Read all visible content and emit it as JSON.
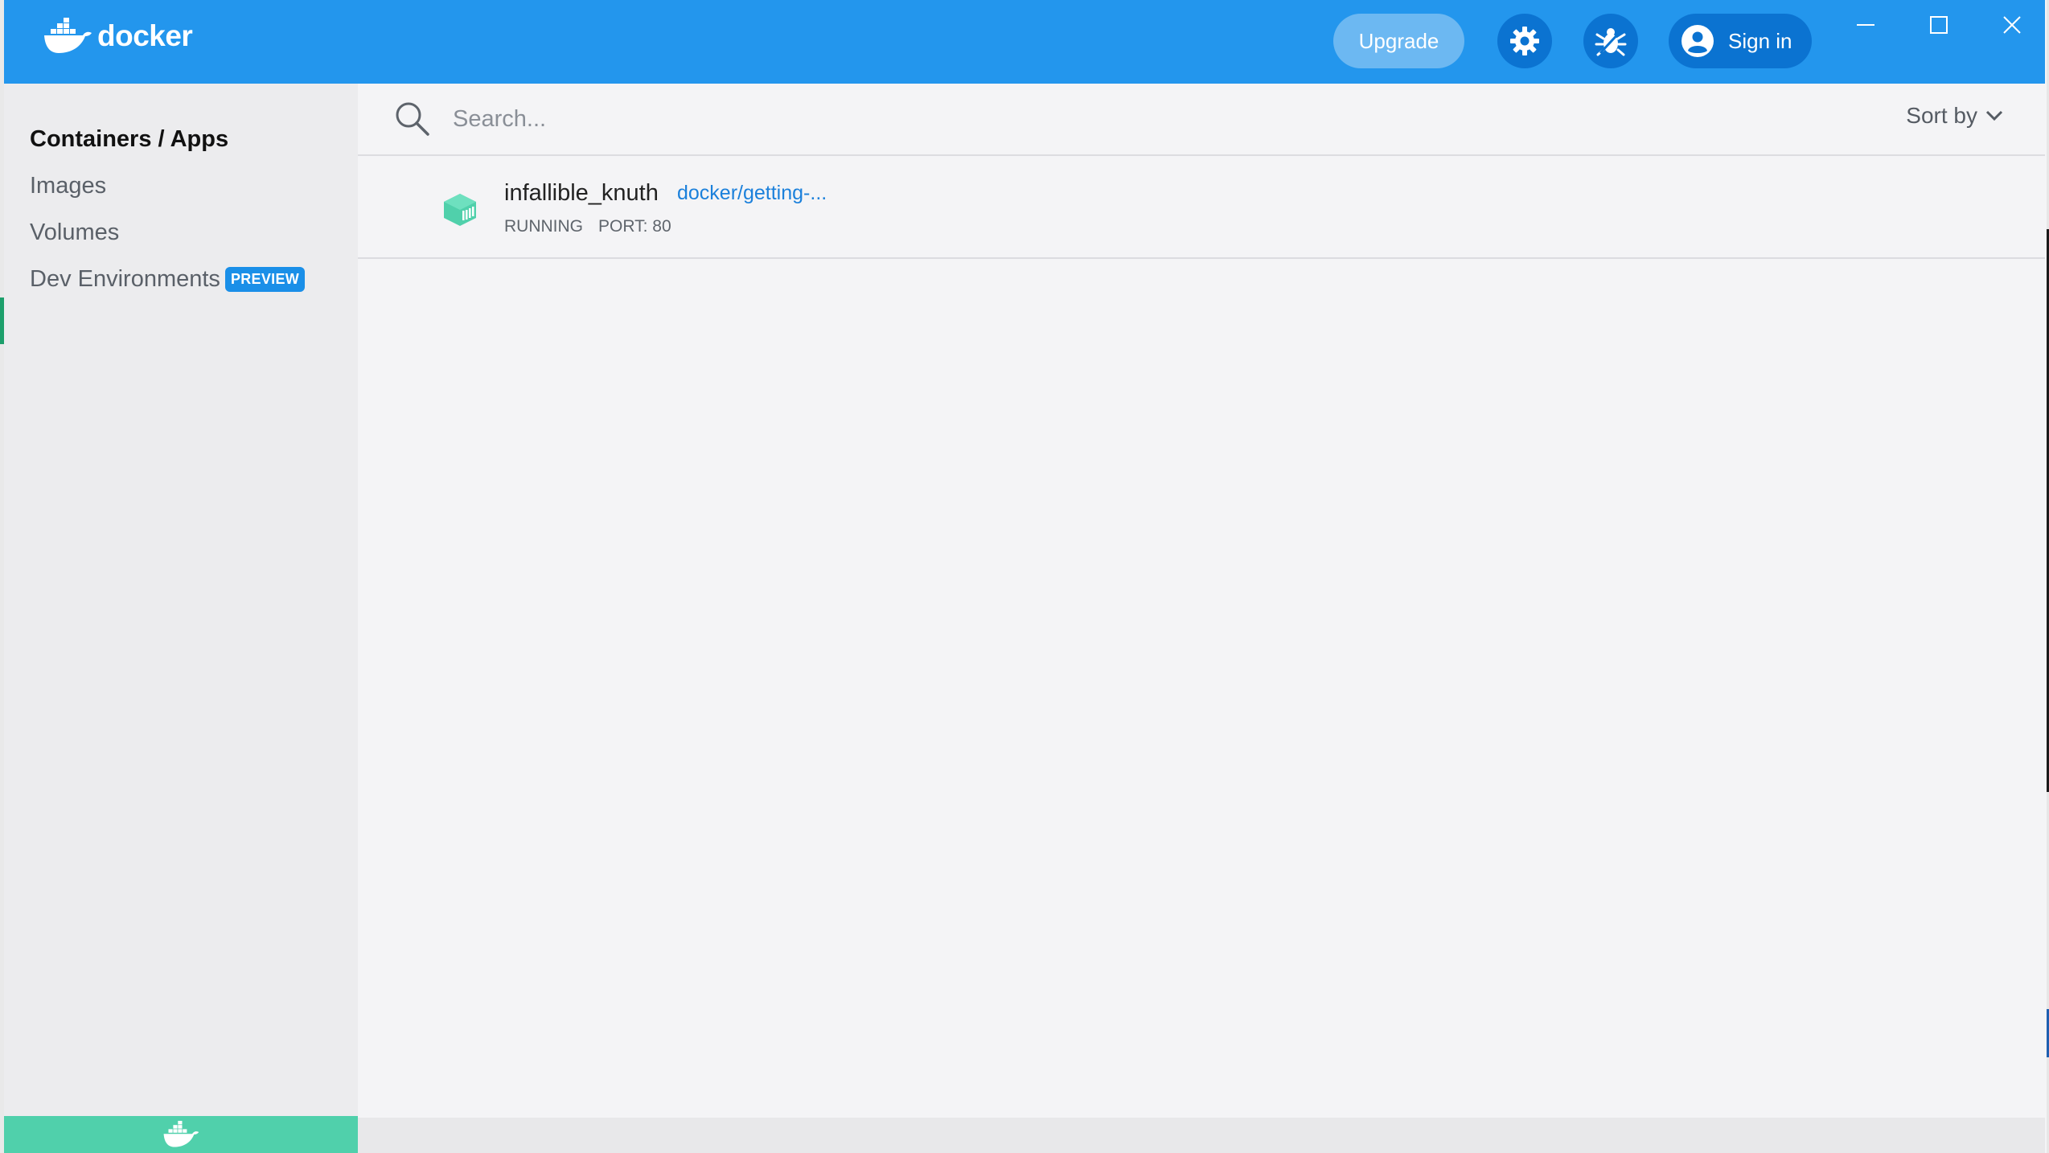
{
  "app": {
    "logo_text": "docker",
    "upgrade_label": "Upgrade",
    "signin_label": "Sign in"
  },
  "icons": {
    "settings": "gear-icon",
    "troubleshoot": "bug-icon",
    "account": "user-avatar-icon",
    "search": "search-icon",
    "sort": "chevron-down-icon",
    "container": "container-cube-icon",
    "footer": "docker-whale-icon"
  },
  "colors": {
    "header": "#2396ed",
    "accent": "#1b80db",
    "running": "#50d0ab",
    "preview_badge": "#1a8fe8"
  },
  "sidebar": {
    "items": [
      {
        "label": "Containers / Apps",
        "active": true
      },
      {
        "label": "Images"
      },
      {
        "label": "Volumes"
      },
      {
        "label": "Dev Environments",
        "badge": "PREVIEW"
      }
    ]
  },
  "search": {
    "placeholder": "Search...",
    "value": ""
  },
  "sort": {
    "label": "Sort by"
  },
  "containers": [
    {
      "name": "infallible_knuth",
      "image": "docker/getting-...",
      "status": "RUNNING",
      "port": "PORT: 80"
    }
  ]
}
